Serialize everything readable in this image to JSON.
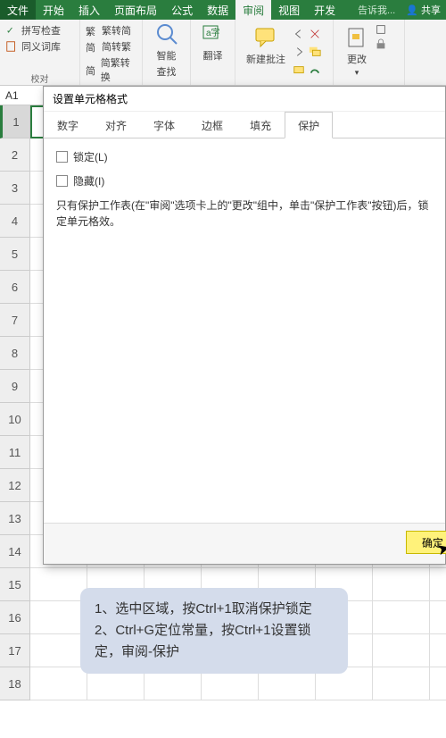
{
  "menu": {
    "file": "文件",
    "tabs": [
      "开始",
      "插入",
      "页面布局",
      "公式",
      "数据",
      "审阅",
      "视图",
      "开发"
    ],
    "active_index": 5,
    "search_hint": "告诉我...",
    "share": "共享"
  },
  "ribbon": {
    "proof": {
      "spellcheck": "拼写检查",
      "thesaurus": "同义词库",
      "group_label": "校对"
    },
    "convert": {
      "s2t": "繁转简",
      "t2s": "简转繁",
      "s2t_toggle": "简繁转换"
    },
    "smart": {
      "label": "智能",
      "sub": "查找"
    },
    "translate": {
      "label": "翻译"
    },
    "comment": {
      "new": "新建批注"
    },
    "change": {
      "label": "更改"
    }
  },
  "namebox": {
    "value": "A1"
  },
  "rows": [
    "1",
    "2",
    "3",
    "4",
    "5",
    "6",
    "7",
    "8",
    "9",
    "10",
    "11",
    "12",
    "13",
    "14",
    "15",
    "16",
    "17",
    "18"
  ],
  "dialog": {
    "title": "设置单元格格式",
    "tabs": [
      "数字",
      "对齐",
      "字体",
      "边框",
      "填充",
      "保护"
    ],
    "active_tab": 5,
    "lock_label": "锁定(L)",
    "hide_label": "隐藏(I)",
    "hint": "只有保护工作表(在\"审阅\"选项卡上的\"更改\"组中，单击\"保护工作表\"按钮)后，锁定单元格效。",
    "ok": "确定"
  },
  "callout": {
    "line1": "1、选中区域，按Ctrl+1取消保护锁定",
    "line2": "2、Ctrl+G定位常量，按Ctrl+1设置锁定，审阅-保护"
  }
}
